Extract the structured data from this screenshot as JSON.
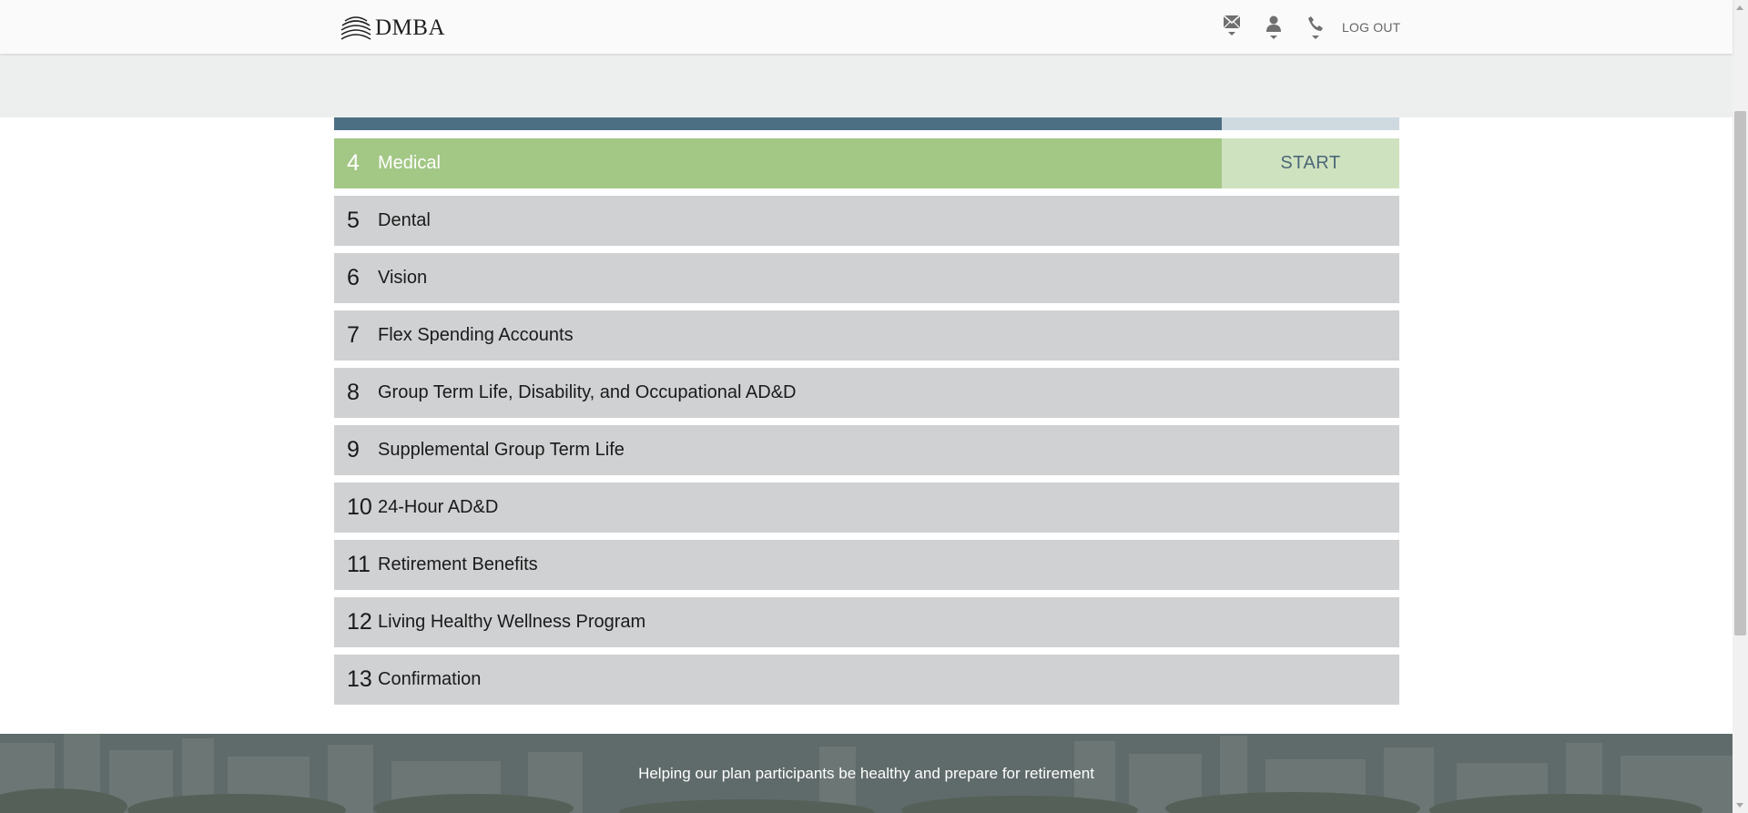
{
  "header": {
    "logo_text": "DMBA",
    "icons": [
      {
        "name": "mail-icon"
      },
      {
        "name": "user-icon"
      },
      {
        "name": "phone-icon"
      }
    ],
    "logout_label": "LOG OUT"
  },
  "progress": {
    "fraction": 0.833
  },
  "steps": [
    {
      "number": "4",
      "label": "Medical",
      "active": true,
      "action": "START"
    },
    {
      "number": "5",
      "label": "Dental"
    },
    {
      "number": "6",
      "label": "Vision"
    },
    {
      "number": "7",
      "label": "Flex Spending Accounts"
    },
    {
      "number": "8",
      "label": "Group Term Life, Disability, and Occupational AD&D"
    },
    {
      "number": "9",
      "label": "Supplemental Group Term Life"
    },
    {
      "number": "10",
      "label": "24-Hour AD&D"
    },
    {
      "number": "11",
      "label": "Retirement Benefits"
    },
    {
      "number": "12",
      "label": "Living Healthy Wellness Program"
    },
    {
      "number": "13",
      "label": "Confirmation"
    }
  ],
  "footer": {
    "tagline": "Helping our plan participants be healthy and prepare for retirement"
  },
  "colors": {
    "progress_fill": "#4d6f83",
    "progress_track": "#cfd9e0",
    "active_step": "#a3c785",
    "start_button": "#cfe2bf",
    "inactive_step": "#d0d1d3"
  }
}
